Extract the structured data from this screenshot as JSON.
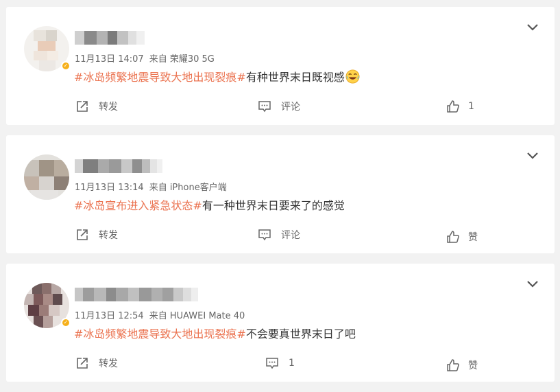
{
  "colors": {
    "background": "#f2f2f2",
    "card": "#ffffff",
    "topic": "#eb7350",
    "meta": "#666666",
    "verified_badge": "#f6b01a"
  },
  "posts": [
    {
      "verified": true,
      "time": "11月13日 14:07",
      "source": "来自 荣耀30 5G",
      "topic": "#冰岛频繁地震导致大地出现裂痕#",
      "text": "有种世界末日既视感",
      "emoji": "laugh-cry-emoji",
      "repost_label": "转发",
      "comment_label": "评论",
      "like_label": "1"
    },
    {
      "verified": false,
      "time": "11月13日 13:14",
      "source": "来自 iPhone客户端",
      "topic": "#冰岛宣布进入紧急状态#",
      "text": "有一种世界末日要来了的感觉",
      "repost_label": "转发",
      "comment_label": "评论",
      "like_label": "赞"
    },
    {
      "verified": true,
      "time": "11月13日 12:54",
      "source": "来自 HUAWEI Mate 40",
      "topic": "#冰岛频繁地震导致大地出现裂痕#",
      "text": "不会要真世界末日了吧",
      "repost_label": "转发",
      "comment_label": "1",
      "like_label": "赞"
    }
  ]
}
